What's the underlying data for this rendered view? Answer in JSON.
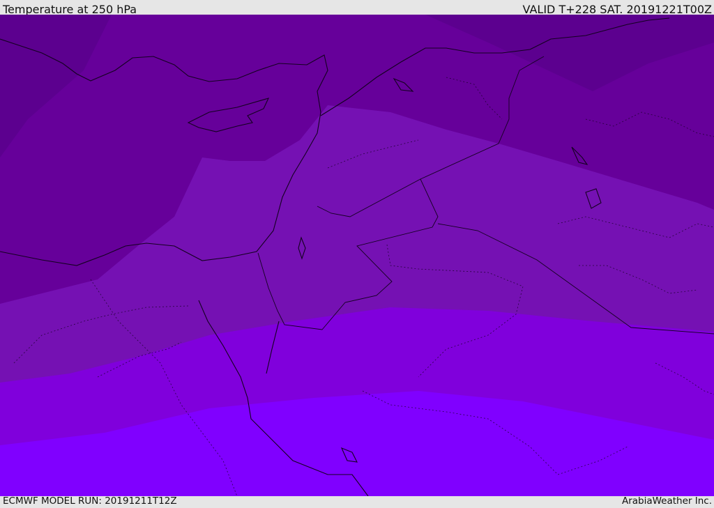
{
  "header": {
    "title": "Temperature at 250 hPa",
    "valid_time": "VALID T+228 SAT. 20191221T00Z"
  },
  "footer": {
    "model_run": "ECMWF MODEL RUN: 20191211T12Z",
    "credit": "ArabiaWeather Inc."
  },
  "map": {
    "colors": {
      "band_darkest": "#5c008f",
      "band_dark": "#66009a",
      "band_mid": "#7511b3",
      "band_light": "#8000dc",
      "band_lightest": "#8000ff",
      "line": "#140020"
    }
  }
}
